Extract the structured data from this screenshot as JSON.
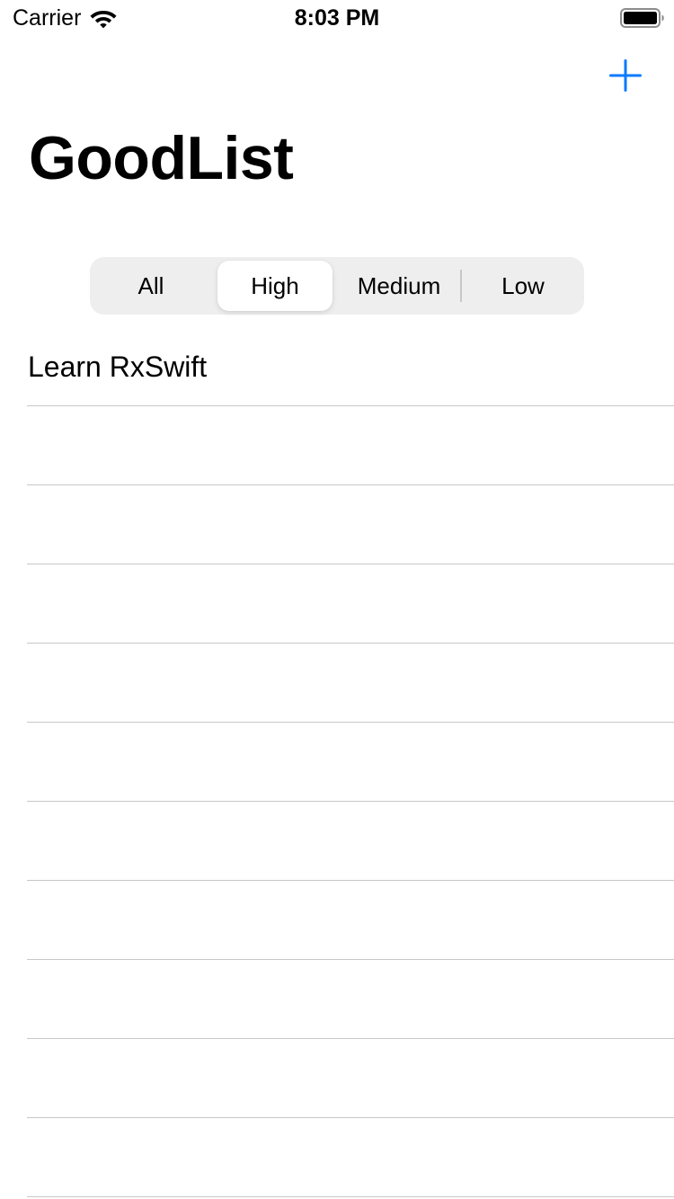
{
  "status_bar": {
    "carrier": "Carrier",
    "time": "8:03 PM",
    "wifi_icon": "wifi-icon",
    "battery_icon": "battery-full-icon"
  },
  "nav": {
    "add_icon": "plus-icon",
    "title": "GoodList",
    "accent_color": "#0a7aff"
  },
  "segments": {
    "items": [
      "All",
      "High",
      "Medium",
      "Low"
    ],
    "selected": "High"
  },
  "list": {
    "items": [
      "Learn RxSwift",
      "",
      "",
      "",
      "",
      "",
      "",
      "",
      "",
      "",
      ""
    ]
  }
}
